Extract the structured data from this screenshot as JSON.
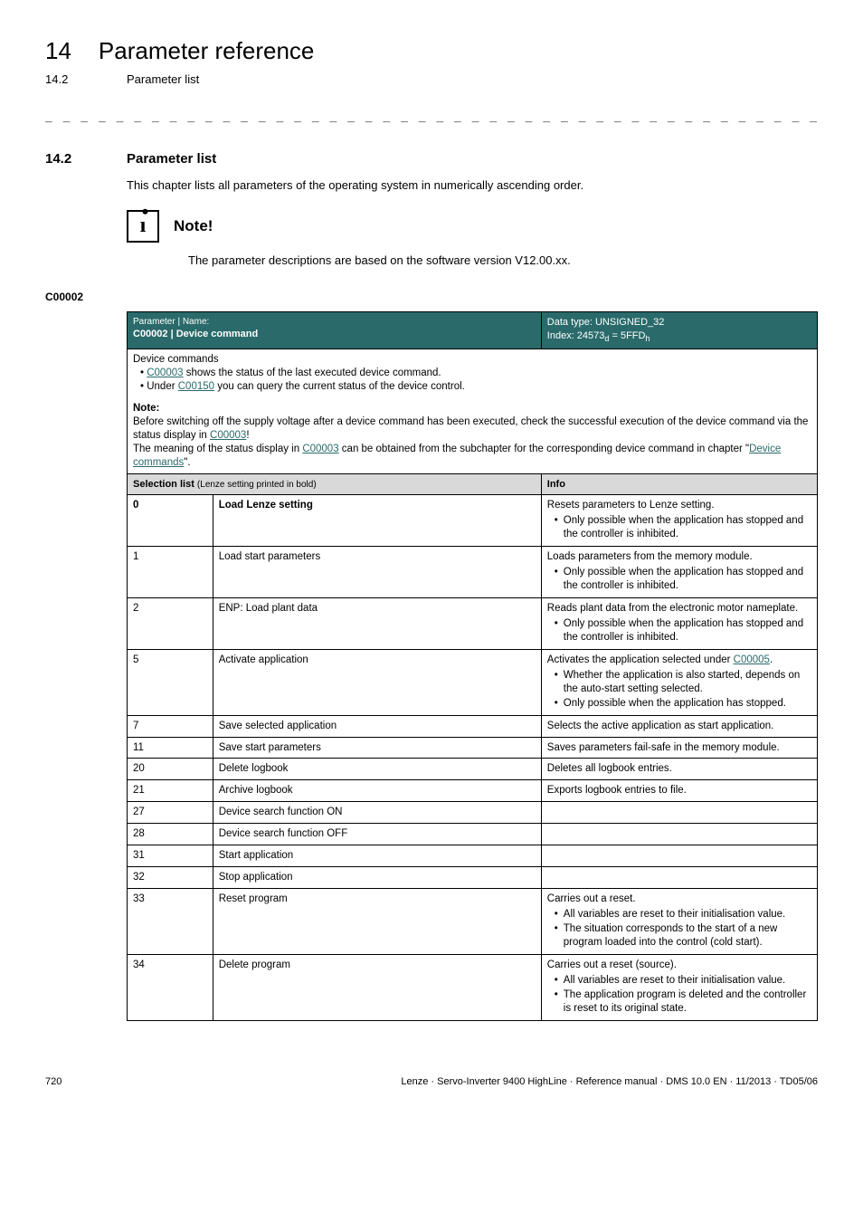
{
  "chapter": {
    "num": "14",
    "title": "Parameter reference"
  },
  "subsection_top": {
    "num": "14.2",
    "title": "Parameter list"
  },
  "section": {
    "num": "14.2",
    "title": "Parameter list"
  },
  "intro_para": "This chapter lists all parameters of the operating system in numerically ascending order.",
  "note": {
    "label": "Note!",
    "text": "The parameter descriptions are based on the software version V12.00.xx."
  },
  "param_code": "C00002",
  "header": {
    "name_label": "Parameter | Name:",
    "name_value": "C00002 | Device command",
    "dtype_label": "Data type: UNSIGNED_32",
    "index_prefix": "Index: 24573",
    "index_sub_d": "d",
    "index_eq": " = 5FFD",
    "index_sub_h": "h"
  },
  "desc": {
    "title": "Device commands",
    "b1_pre": "• ",
    "b1_link": "C00003",
    "b1_post": " shows the status of the last executed device command.",
    "b2_pre": "• Under ",
    "b2_link": "C00150",
    "b2_post": " you can query the current status of the device control.",
    "note_label": "Note:",
    "note_l1_pre": "Before switching off the supply voltage after a device command has been executed, check the successful execution of the device command via the status display in ",
    "note_l1_link": "C00003",
    "note_l1_post": "!",
    "note_l2_pre": "The meaning of the status display in ",
    "note_l2_link": "C00003",
    "note_l2_mid": " can be obtained from the subchapter for the corresponding device command in chapter \"",
    "note_l2_link2": "Device commands",
    "note_l2_post": "\"."
  },
  "sel_header": {
    "c1_main": "Selection list ",
    "c1_small": "(Lenze setting printed in bold)",
    "c2": "Info"
  },
  "rows": [
    {
      "n": "0",
      "label": "Load Lenze setting",
      "bold": true,
      "info_main": "Resets parameters to Lenze setting.",
      "bullets": [
        "Only possible when the application has stopped and the controller is inhibited."
      ]
    },
    {
      "n": "1",
      "label": "Load start parameters",
      "info_main": "Loads parameters from the memory module.",
      "bullets": [
        "Only possible when the application has stopped and the controller is inhibited."
      ]
    },
    {
      "n": "2",
      "label": "ENP: Load plant data",
      "info_main": "Reads plant data from the electronic motor nameplate.",
      "bullets": [
        "Only possible when the application has stopped and the controller is inhibited."
      ]
    },
    {
      "n": "5",
      "label": "Activate application",
      "info_main_pre": "Activates the application selected under ",
      "info_main_link": "C00005",
      "info_main_post": ".",
      "bullets": [
        "Whether the application is also started, depends on the auto-start setting selected.",
        "Only possible when the application has stopped."
      ]
    },
    {
      "n": "7",
      "label": "Save selected application",
      "info_main": "Selects the active application as start application."
    },
    {
      "n": "11",
      "label": "Save start parameters",
      "info_main": "Saves parameters fail-safe in the memory module."
    },
    {
      "n": "20",
      "label": "Delete logbook",
      "info_main": "Deletes all logbook entries."
    },
    {
      "n": "21",
      "label": "Archive logbook",
      "info_main": "Exports logbook entries to file."
    },
    {
      "n": "27",
      "label": "Device search function ON",
      "info_main": ""
    },
    {
      "n": "28",
      "label": "Device search function OFF",
      "info_main": ""
    },
    {
      "n": "31",
      "label": "Start application",
      "info_main": ""
    },
    {
      "n": "32",
      "label": "Stop application",
      "info_main": ""
    },
    {
      "n": "33",
      "label": "Reset program",
      "info_main": "Carries out a reset.",
      "bullets": [
        "All variables are reset to their initialisation value.",
        "The situation corresponds to the start of a new program loaded into the control (cold start)."
      ]
    },
    {
      "n": "34",
      "label": "Delete program",
      "info_main": "Carries out a reset (source).",
      "bullets": [
        "All variables are reset to their initialisation value.",
        "The application program is deleted and the controller is reset to its original state."
      ]
    }
  ],
  "footer": {
    "page": "720",
    "line": "Lenze · Servo-Inverter 9400 HighLine · Reference manual · DMS 10.0 EN · 11/2013 · TD05/06"
  }
}
